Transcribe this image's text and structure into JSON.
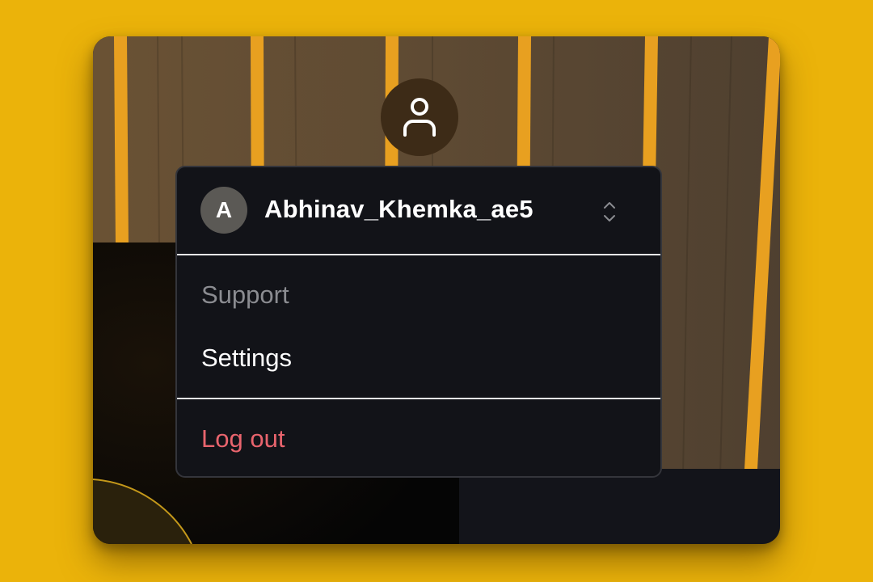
{
  "colors": {
    "page_background": "#ebb30a",
    "menu_background": "#121318",
    "logout_color": "#e8646d",
    "muted_text": "#8b8c91",
    "avatar_background": "#5b5955",
    "profile_button_background": "#3d2b17"
  },
  "profile_button": {
    "icon": "user-icon"
  },
  "menu": {
    "account": {
      "avatar_initial": "A",
      "username": "Abhinav_Khemka_ae5",
      "switcher_icon": "chevron-up-down-icon"
    },
    "items": [
      {
        "label": "Support"
      },
      {
        "label": "Settings"
      }
    ],
    "logout_label": "Log out"
  }
}
